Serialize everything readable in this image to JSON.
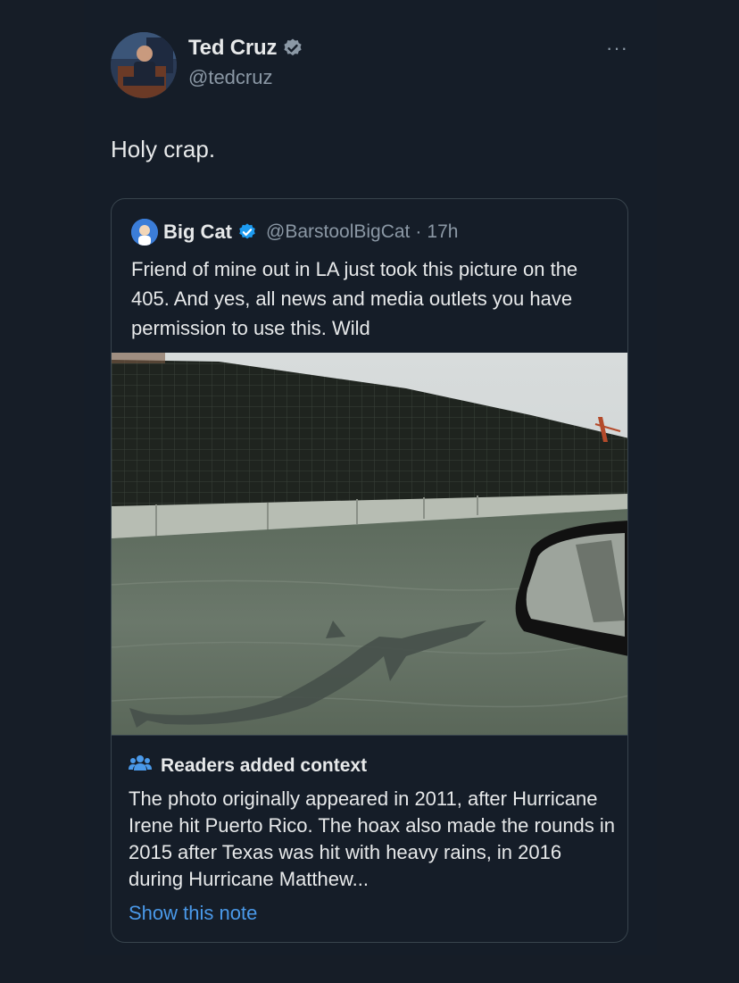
{
  "tweet": {
    "author_name": "Ted Cruz",
    "author_handle": "@tedcruz",
    "more_label": "···",
    "text": "Holy crap."
  },
  "quoted_tweet": {
    "author_name": "Big Cat",
    "author_handle": "@BarstoolBigCat",
    "separator": "·",
    "time": "17h",
    "text": "Friend of mine out in LA just took this picture on the 405. And yes, all news and media outlets you have permission to use this. Wild"
  },
  "community_note": {
    "title": "Readers added context",
    "icon": "people-icon",
    "body": "The photo originally appeared in 2011, after Hurricane Irene hit Puerto Rico. The hoax also made the rounds in 2015 after Texas was hit with heavy rains, in 2016 during Hurricane Matthew...",
    "link": "Show this note"
  },
  "colors": {
    "background": "#161d27",
    "text": "#e7e9ea",
    "secondary": "#8b98a5",
    "accent": "#4a99e9",
    "verified": "#1d9bf0"
  }
}
